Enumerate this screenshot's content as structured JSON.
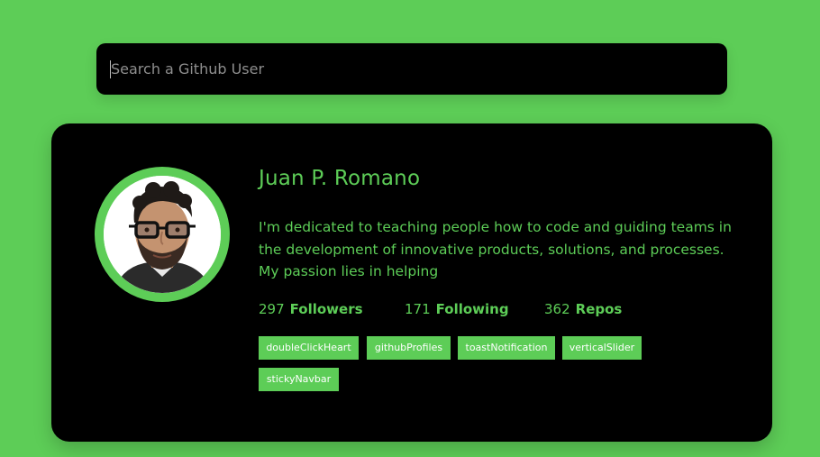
{
  "search": {
    "placeholder": "Search a Github User"
  },
  "profile": {
    "name": "Juan P. Romano",
    "bio": "I'm dedicated to teaching people how to code and guiding teams in the development of innovative products, solutions, and processes. My passion lies in helping",
    "stats": {
      "followers_count": "297",
      "followers_label": "Followers",
      "following_count": "171",
      "following_label": "Following",
      "repos_count": "362",
      "repos_label": "Repos"
    },
    "repos": [
      "doubleClickHeart",
      "githubProfiles",
      "toastNotification",
      "verticalSlider",
      "stickyNavbar"
    ]
  },
  "colors": {
    "accent": "#5dcd57",
    "card": "#000000",
    "tag_text": "#ffffff"
  }
}
